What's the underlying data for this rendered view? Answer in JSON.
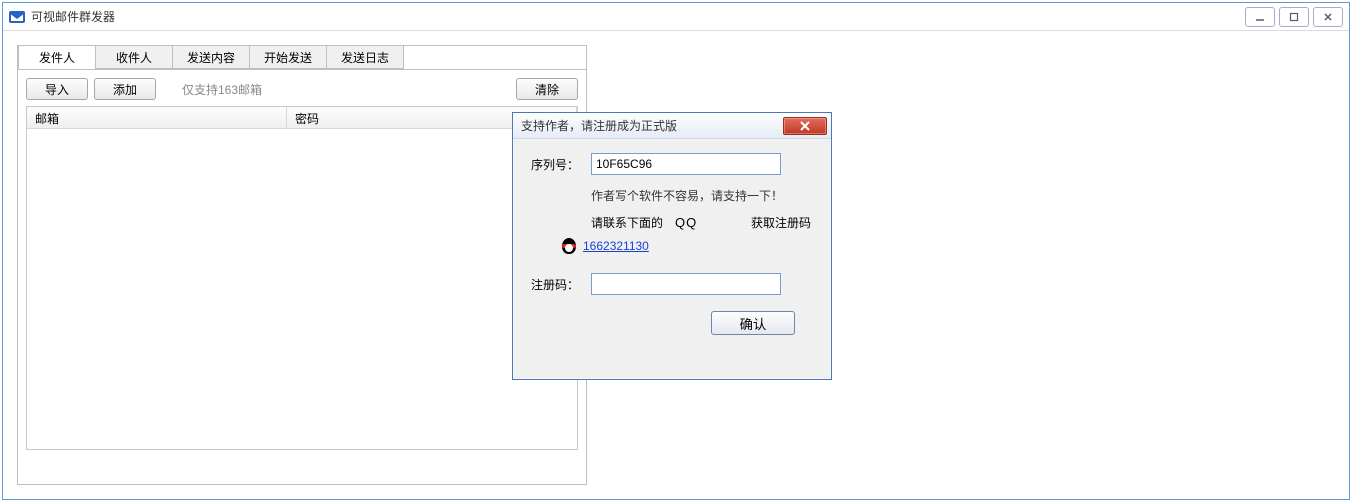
{
  "window": {
    "title": "可视邮件群发器"
  },
  "tabs": [
    {
      "label": "发件人",
      "active": true
    },
    {
      "label": "收件人",
      "active": false
    },
    {
      "label": "发送内容",
      "active": false
    },
    {
      "label": "开始发送",
      "active": false
    },
    {
      "label": "发送日志",
      "active": false
    }
  ],
  "toolbar": {
    "import_label": "导入",
    "add_label": "添加",
    "hint": "仅支持163邮箱",
    "clear_label": "清除"
  },
  "grid": {
    "col1": "邮箱",
    "col2": "密码"
  },
  "dialog": {
    "title": "支持作者，请注册成为正式版",
    "serial_label": "序列号：",
    "serial_value": "10F65C96",
    "support_line": "作者写个软件不容易，请支持一下！",
    "contact_prefix": "请联系下面的",
    "contact_mid": "QQ",
    "contact_suffix": "获取注册码",
    "qq_number": "1662321130",
    "regcode_label": "注册码：",
    "regcode_value": "",
    "confirm_label": "确认"
  }
}
